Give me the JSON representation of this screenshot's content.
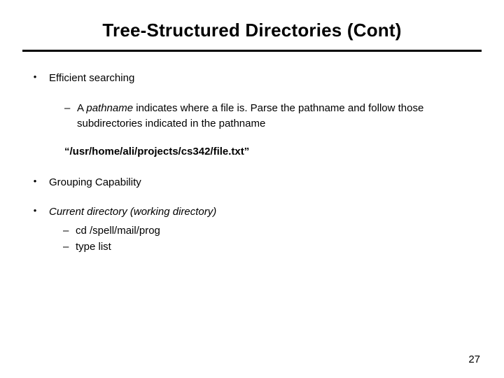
{
  "title": "Tree-Structured Directories (Cont)",
  "bullets": {
    "b1": "Efficient searching",
    "b1_sub_dash": "–",
    "b1_sub_a": "A ",
    "b1_sub_pathname_word": "pathname",
    "b1_sub_b": " indicates where a file is. Parse the pathname and follow those subdirectories indicated in the pathname",
    "b1_path": "“/usr/home/ali/projects/cs342/file.txt”",
    "b2": "Grouping Capability",
    "b3_a": "Current directory (",
    "b3_b": "working directory",
    "b3_c": ")",
    "b3_sub1": "cd /spell/mail/prog",
    "b3_sub2": "type list"
  },
  "dot": "•",
  "dash": "–",
  "pagenum": "27"
}
